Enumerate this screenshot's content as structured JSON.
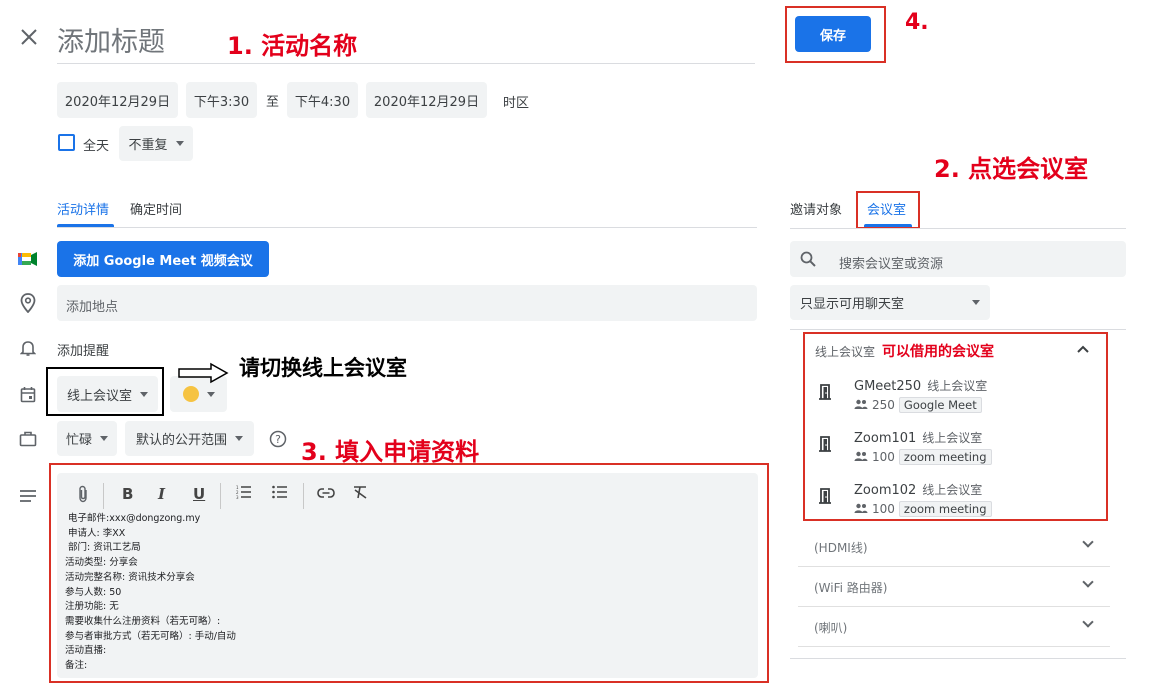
{
  "header": {
    "close_icon": "close-icon",
    "title_placeholder": "添加标题",
    "save_label": "保存"
  },
  "datetime": {
    "start_date": "2020年12月29日",
    "start_time": "下午3:30",
    "separator": "至",
    "end_time": "下午4:30",
    "end_date": "2020年12月29日",
    "timezone_label": "时区",
    "all_day_label": "全天",
    "repeat_value": "不重复"
  },
  "tabs": {
    "details": "活动详情",
    "find_time": "确定时间",
    "guests": "邀请对象",
    "rooms": "会议室"
  },
  "details": {
    "meet_button": "添加 Google Meet 视频会议",
    "location_placeholder": "添加地点",
    "reminder_label": "添加提醒",
    "calendar_value": "线上会议室",
    "color_value": "#f6c342",
    "busy_value": "忙碌",
    "visibility_value": "默认的公开范围",
    "description_lines": [
      "电子邮件:xxx@dongzong.my",
      "申请人: 李XX",
      "部门: 资讯工艺局",
      "活动类型: 分享会",
      "活动完整名称: 资讯技术分享会",
      "参与人数: 50",
      "注册功能: 无",
      "需要收集什么注册资料（若无可略）:",
      "参与者审批方式（若无可略）: 手动/自动",
      "活动直播:",
      "备注:"
    ]
  },
  "rooms_panel": {
    "search_placeholder": "搜索会议室或资源",
    "filter_value": "只显示可用聊天室",
    "group_label": "线上会议室",
    "rooms": [
      {
        "name": "GMeet250",
        "type": "线上会议室",
        "capacity": "250",
        "tag": "Google Meet"
      },
      {
        "name": "Zoom101",
        "type": "线上会议室",
        "capacity": "100",
        "tag": "zoom meeting"
      },
      {
        "name": "Zoom102",
        "type": "线上会议室",
        "capacity": "100",
        "tag": "zoom meeting"
      }
    ],
    "categories": [
      "(HDMI线)",
      "(WiFi 路由器)",
      "(喇叭)"
    ]
  },
  "annotations": {
    "step1": "1. 活动名称",
    "step2": "2. 点选会议室",
    "step3": "3. 填入申请资料",
    "step4": "4.",
    "switch_hint": "请切换线上会议室",
    "rooms_note": "可以借用的会议室"
  },
  "colors": {
    "accent": "#1a73e8",
    "annotation_red": "#e3001b"
  }
}
